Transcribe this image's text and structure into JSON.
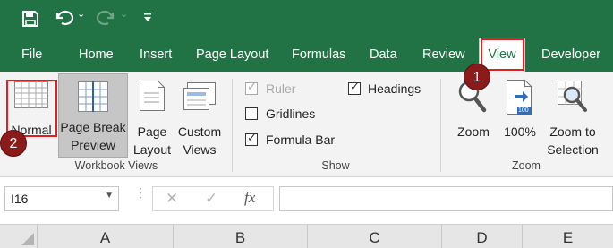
{
  "tabs": {
    "file": "File",
    "home": "Home",
    "insert": "Insert",
    "page_layout": "Page Layout",
    "formulas": "Formulas",
    "data": "Data",
    "review": "Review",
    "view": "View",
    "developer": "Developer"
  },
  "ribbon": {
    "workbook_views": {
      "group_label": "Workbook Views",
      "normal": "Normal",
      "page_break_line1": "Page Break",
      "page_break_line2": "Preview",
      "page_layout_line1": "Page",
      "page_layout_line2": "Layout",
      "custom_views_line1": "Custom",
      "custom_views_line2": "Views"
    },
    "show": {
      "group_label": "Show",
      "ruler": "Ruler",
      "gridlines": "Gridlines",
      "formula_bar": "Formula Bar",
      "headings": "Headings"
    },
    "zoom": {
      "group_label": "Zoom",
      "zoom": "Zoom",
      "hundred": "100%",
      "hundred_icon_text": "100",
      "zoom_sel_line1": "Zoom to",
      "zoom_sel_line2": "Selection"
    }
  },
  "checkboxes": {
    "ruler_checked": true,
    "ruler_disabled": true,
    "gridlines_checked": false,
    "formula_bar_checked": true,
    "headings_checked": true
  },
  "formula_bar": {
    "name_box": "I16",
    "cancel_symbol": "✕",
    "enter_symbol": "✓",
    "fx_symbol": "fx",
    "value": ""
  },
  "columns": [
    "A",
    "B",
    "C",
    "D",
    "E"
  ],
  "annotations": {
    "badge_1": "1",
    "badge_2": "2"
  },
  "colors": {
    "excel_green": "#217346",
    "annotation_red": "#e02020",
    "badge_fill": "#8b1a1a"
  }
}
